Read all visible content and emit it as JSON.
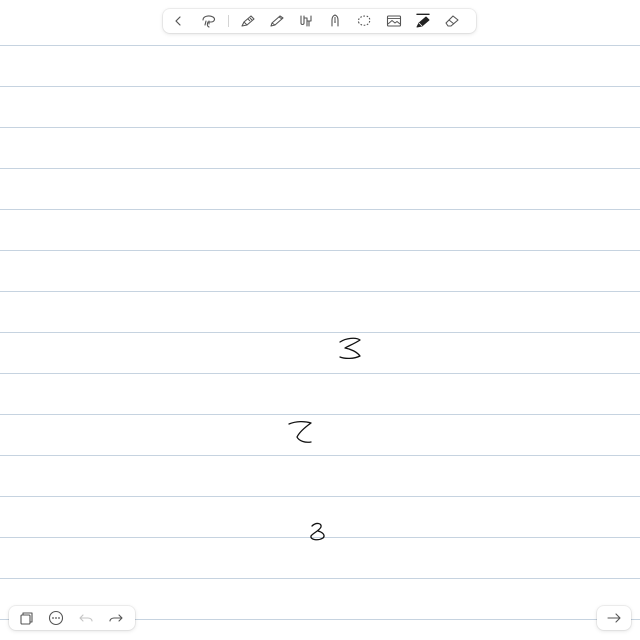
{
  "colors": {
    "rule_line": "#c6d3e0",
    "icon": "#555555",
    "icon_disabled": "#c4c4c4",
    "ink": "#111111",
    "toolbar_bg": "#ffffff"
  },
  "toolbar": {
    "tools": [
      {
        "id": "back",
        "icon": "chevron-left-icon"
      },
      {
        "id": "lasso-hand",
        "icon": "lasso-icon"
      },
      {
        "id": "pen",
        "icon": "pen-icon"
      },
      {
        "id": "pencil",
        "icon": "pencil-icon"
      },
      {
        "id": "brush",
        "icon": "brush-icon"
      },
      {
        "id": "fountain-pen",
        "icon": "fountain-pen-icon"
      },
      {
        "id": "lasso-select",
        "icon": "lasso-select-icon"
      },
      {
        "id": "image",
        "icon": "image-icon"
      },
      {
        "id": "highlighter",
        "icon": "highlighter-icon",
        "selected": true
      },
      {
        "id": "eraser",
        "icon": "eraser-icon"
      }
    ]
  },
  "bottom_toolbar": {
    "buttons": [
      {
        "id": "pages",
        "icon": "pages-icon"
      },
      {
        "id": "more",
        "icon": "more-icon"
      },
      {
        "id": "undo",
        "icon": "undo-icon",
        "disabled": true
      },
      {
        "id": "redo",
        "icon": "redo-icon"
      }
    ]
  },
  "nav": {
    "next": {
      "icon": "arrow-right-icon"
    }
  }
}
